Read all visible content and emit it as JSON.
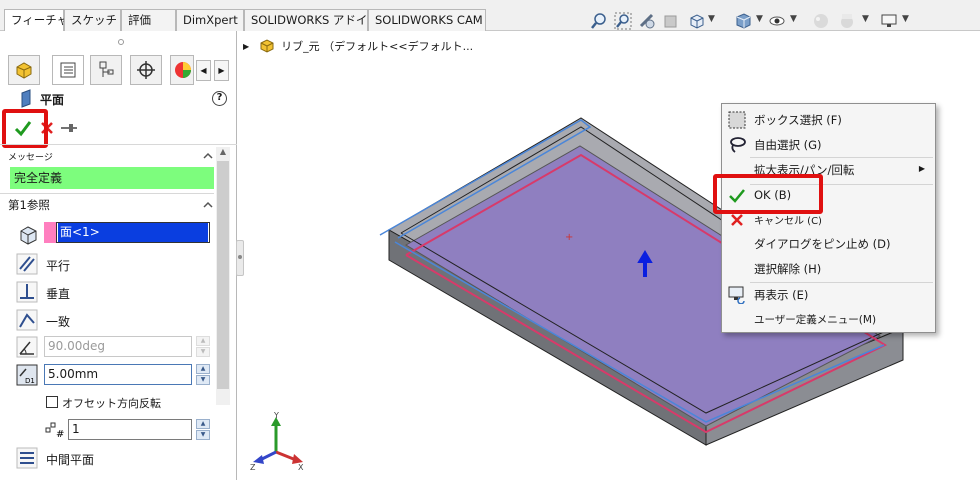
{
  "tabs": [
    "フィーチャー",
    "スケッチ",
    "評価",
    "DimXpert",
    "SOLIDWORKS アドイン",
    "SOLIDWORKS CAM"
  ],
  "active_tab": 0,
  "feature_tree": {
    "item": "リブ_元 （デフォルト<<デフォルト..."
  },
  "panel": {
    "title": "平面",
    "help": "?",
    "message_header": "メッセージ",
    "message_text": "完全定義",
    "ref1_header": "第1参照",
    "ref1_value": "面<1>",
    "options": [
      "平行",
      "垂直",
      "一致"
    ],
    "angle_value": "90.00deg",
    "offset_value": "5.00mm",
    "flip_label": "オフセット方向反転",
    "count_value": "1",
    "mid_plane": "中間平面"
  },
  "context_menu": {
    "items": [
      {
        "label": "ボックス選択 (F)",
        "icon": "box-select-icon"
      },
      {
        "label": "自由選択 (G)",
        "icon": "lasso-icon"
      },
      {
        "label": "拡大表示/パン/回転",
        "icon": "",
        "submenu": true
      },
      {
        "label": "OK (B)",
        "icon": "check-icon"
      },
      {
        "label": "キャンセル (C)",
        "icon": "cancel-icon"
      },
      {
        "label": "ダイアログをピン止め (D)",
        "icon": ""
      },
      {
        "label": "選択解除 (H)",
        "icon": ""
      },
      {
        "label": "再表示 (E)",
        "icon": "redraw-icon"
      },
      {
        "label": "ユーザー定義メニュー(M)",
        "icon": ""
      }
    ]
  },
  "triad": {
    "x": "X",
    "y": "Y",
    "z": "Z"
  },
  "colors": {
    "message_bg": "#7dfd7d",
    "selected_field": "#0a3ee0",
    "pink_marker": "#ff7fbf",
    "highlight": "#e01010",
    "face": "#8f7fc0"
  }
}
